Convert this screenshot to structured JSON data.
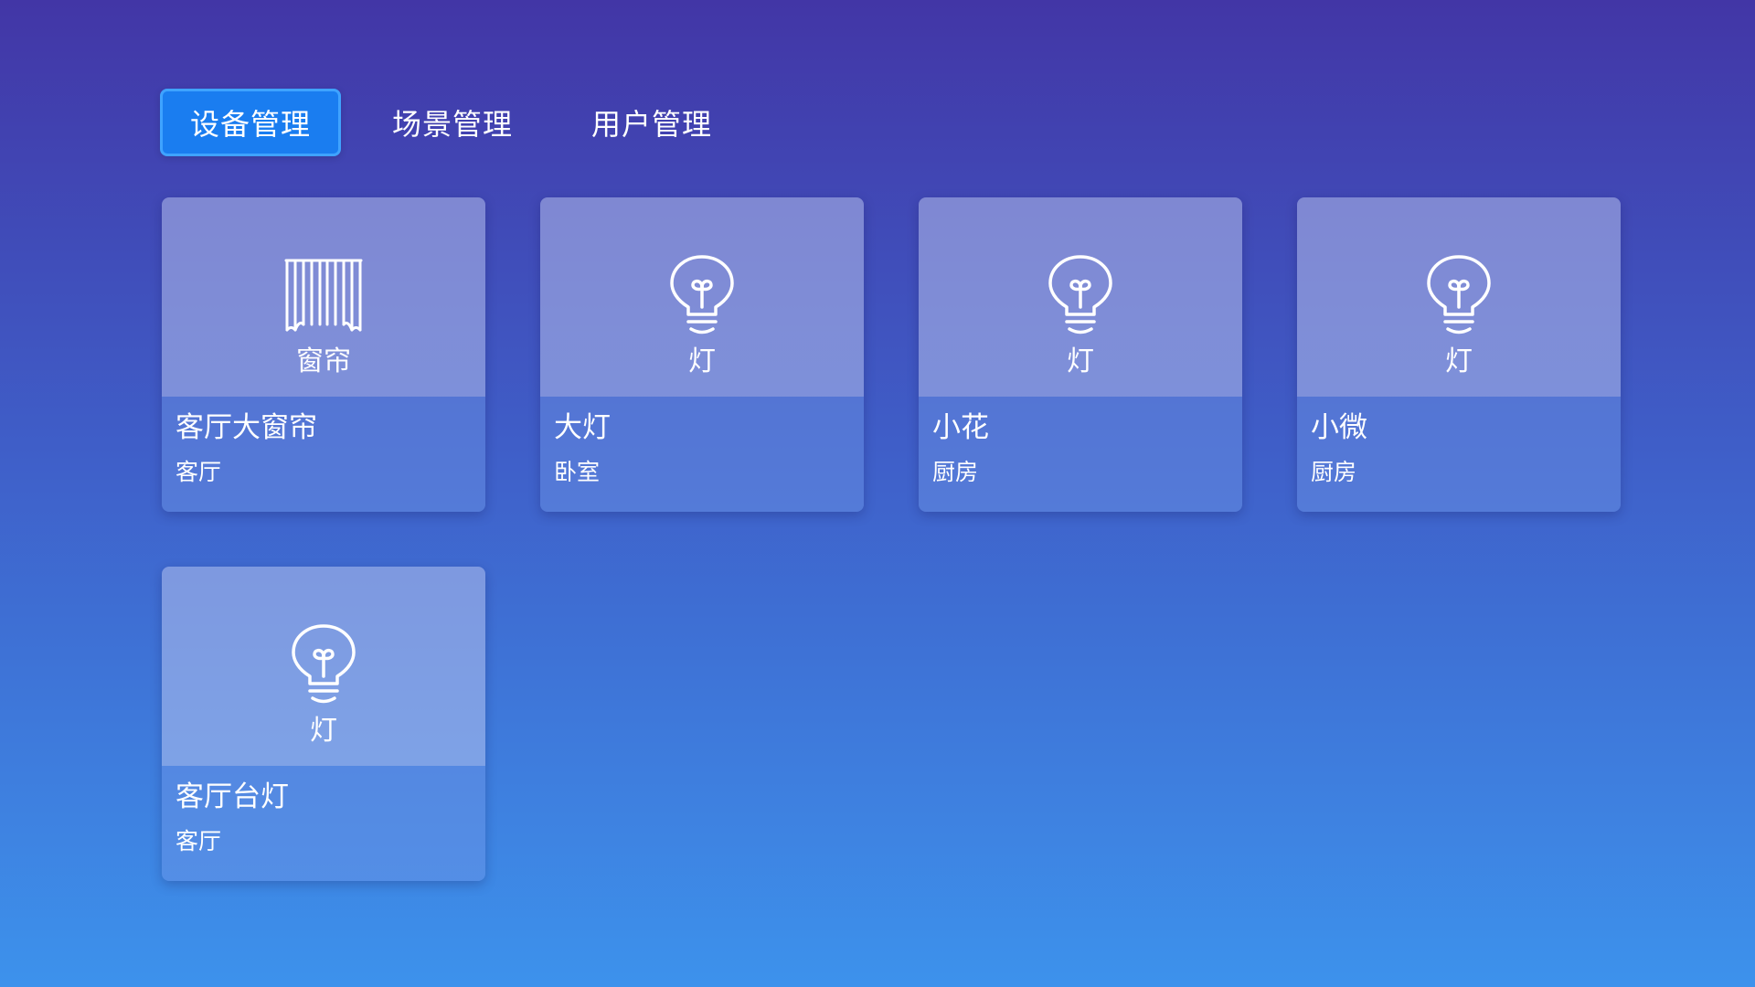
{
  "tabs": [
    {
      "label": "设备管理",
      "active": true
    },
    {
      "label": "场景管理",
      "active": false
    },
    {
      "label": "用户管理",
      "active": false
    }
  ],
  "devices": [
    {
      "icon": "curtain-icon",
      "type": "窗帘",
      "name": "客厅大窗帘",
      "room": "客厅"
    },
    {
      "icon": "light-bulb-icon",
      "type": "灯",
      "name": "大灯",
      "room": "卧室"
    },
    {
      "icon": "light-bulb-icon",
      "type": "灯",
      "name": "小花",
      "room": "厨房"
    },
    {
      "icon": "light-bulb-icon",
      "type": "灯",
      "name": "小微",
      "room": "厨房"
    },
    {
      "icon": "light-bulb-icon",
      "type": "灯",
      "name": "客厅台灯",
      "room": "客厅"
    }
  ],
  "colors": {
    "active_tab": "#1a7df0",
    "active_tab_border": "#3fa3ff",
    "background_top": "#4236a6",
    "background_bottom": "#3d92ec"
  }
}
